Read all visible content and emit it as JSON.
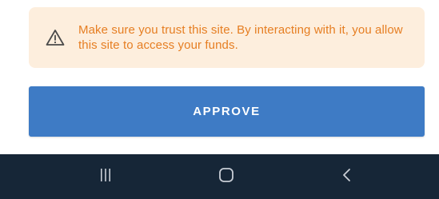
{
  "warning": {
    "text": "Make sure you trust this site. By interacting with it, you allow this site to access your funds.",
    "icon": "warning-triangle-icon",
    "background_color": "#fdeedd",
    "text_color": "#e67e22"
  },
  "approve": {
    "label": "APPROVE",
    "color": "#3e7bc5"
  },
  "navigation_bar": {
    "background_color": "#162637",
    "buttons": [
      {
        "icon": "recent-apps-icon"
      },
      {
        "icon": "home-icon"
      },
      {
        "icon": "back-icon"
      }
    ]
  }
}
